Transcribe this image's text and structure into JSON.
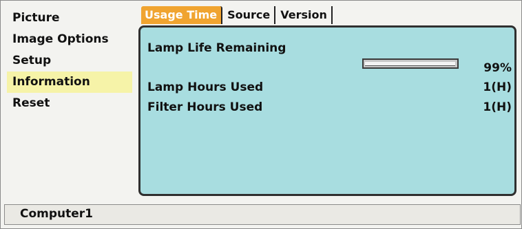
{
  "menu": {
    "items": [
      {
        "label": "Picture"
      },
      {
        "label": "Image Options"
      },
      {
        "label": "Setup"
      },
      {
        "label": "Information",
        "selected": true
      },
      {
        "label": "Reset"
      }
    ]
  },
  "tabs": [
    {
      "label": "Usage Time",
      "active": true
    },
    {
      "label": "Source"
    },
    {
      "label": "Version"
    }
  ],
  "usage": {
    "lamp_life_label": "Lamp Life Remaining",
    "lamp_life_value": "99%",
    "lamp_life_fraction": 0.99,
    "lamp_hours_label": "Lamp Hours Used",
    "lamp_hours_value": "1(H)",
    "filter_hours_label": "Filter Hours Used",
    "filter_hours_value": "1(H)"
  },
  "status": {
    "source": "Computer1"
  },
  "colors": {
    "selected_menu_bg": "#f6f3a8",
    "active_tab_bg": "#f0a430",
    "panel_bg": "#a8dde0"
  }
}
